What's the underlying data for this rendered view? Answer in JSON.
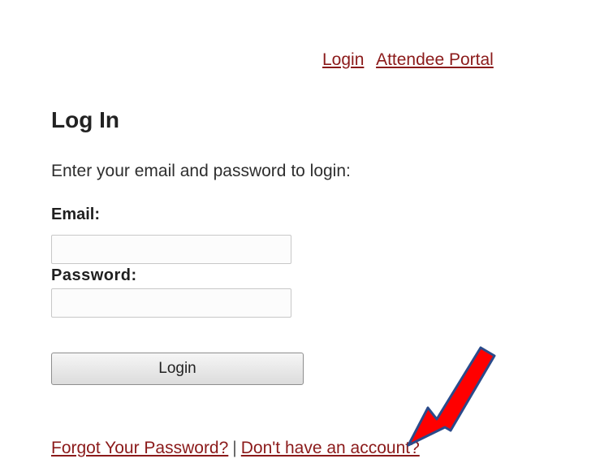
{
  "topnav": {
    "login_link": "Login",
    "portal_link": "Attendee Portal"
  },
  "main": {
    "title": "Log In",
    "instructions": "Enter your email and password to login:",
    "email_label": "Email:",
    "email_value": "",
    "password_label": "Password:",
    "password_value": "",
    "login_button": "Login"
  },
  "footer": {
    "forgot_link": "Forgot Your Password?",
    "separator": "|",
    "signup_link": "Don't have an account?"
  },
  "annotation": {
    "arrow_icon": "red-arrow-icon",
    "arrow_color": "#ff0000",
    "arrow_outline": "#2a4a8a"
  },
  "colors": {
    "link": "#8b1a1a",
    "text": "#2a2a2a"
  }
}
